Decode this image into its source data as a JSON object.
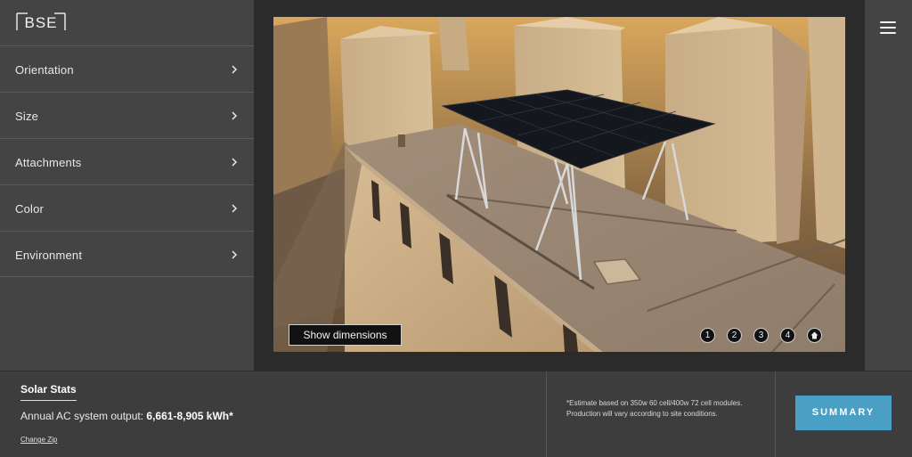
{
  "brand": {
    "logo_text": "BSE"
  },
  "sidebar": {
    "items": [
      {
        "label": "Orientation"
      },
      {
        "label": "Size"
      },
      {
        "label": "Attachments"
      },
      {
        "label": "Color"
      },
      {
        "label": "Environment"
      }
    ]
  },
  "viewer": {
    "show_dimensions_label": "Show dimensions",
    "views": [
      "1",
      "2",
      "3",
      "4"
    ],
    "home_icon": "home-icon"
  },
  "header": {
    "menu_icon": "hamburger-icon"
  },
  "stats": {
    "title": "Solar Stats",
    "output_label": "Annual AC system output: ",
    "output_value": "6,661-8,905 kWh*",
    "change_zip": "Change Zip",
    "note": "*Estimate based on 350w 60 cell/400w 72 cell modules. Production will vary according to site conditions.",
    "summary_label": "SUMMARY"
  },
  "colors": {
    "accent": "#4aa0c4",
    "panel": "#444444",
    "dark": "#2b2b2b"
  }
}
